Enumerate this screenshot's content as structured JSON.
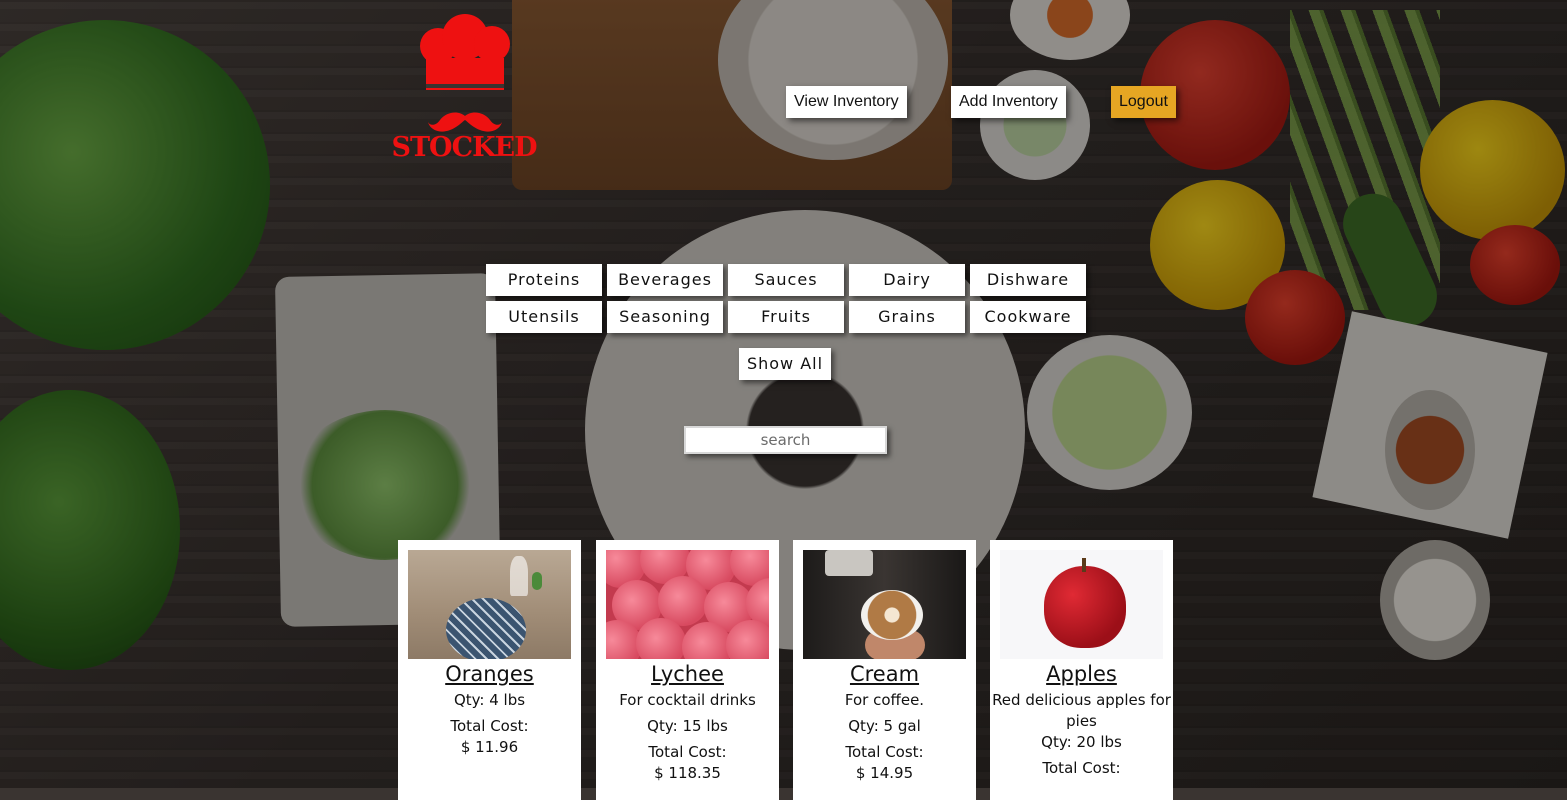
{
  "brand": {
    "name": "STOCKED",
    "logo_icon": "chef-hat-mustache-icon",
    "color": "#ee1111"
  },
  "nav": {
    "view_inventory": "View Inventory",
    "add_inventory": "Add Inventory",
    "logout": "Logout",
    "logout_color": "#e6a623"
  },
  "categories": [
    "Proteins",
    "Beverages",
    "Sauces",
    "Dairy",
    "Dishware",
    "Utensils",
    "Seasoning",
    "Fruits",
    "Grains",
    "Cookware"
  ],
  "show_all": "Show All",
  "search": {
    "placeholder": "search",
    "value": ""
  },
  "items": [
    {
      "name": "Oranges",
      "image": "plate-table-photo",
      "description": "",
      "qty": "Qty: 4 lbs",
      "cost_label": "Total Cost:",
      "cost": "$ 11.96"
    },
    {
      "name": "Lychee",
      "image": "lychee-photo",
      "description": "For cocktail drinks",
      "qty": "Qty: 15 lbs",
      "cost_label": "Total Cost:",
      "cost": "$ 118.35"
    },
    {
      "name": "Cream",
      "image": "latte-art-photo",
      "description": "For coffee.",
      "qty": "Qty: 5 gal",
      "cost_label": "Total Cost:",
      "cost": "$ 14.95"
    },
    {
      "name": "Apples",
      "image": "red-apple-photo",
      "description": "Red delicious apples for pies",
      "qty": "Qty: 20 lbs",
      "cost_label": "Total Cost:",
      "cost": ""
    }
  ]
}
